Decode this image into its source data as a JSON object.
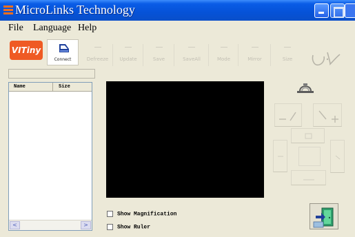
{
  "window": {
    "title": "MicroLinks Technology"
  },
  "menu": [
    "File",
    "Language",
    "Help"
  ],
  "toolbar": {
    "logo_text": "VITiny",
    "connect_label": "Connect",
    "disabled_tools": [
      "Defreeze",
      "Update",
      "Save",
      "SaveAll",
      "Mode",
      "Mirror",
      "Size"
    ]
  },
  "file_list": {
    "columns": [
      "Name",
      "Size"
    ],
    "scroll_left": "<",
    "scroll_right": ">"
  },
  "options": {
    "show_magnification": "Show Magnification",
    "show_ruler": "Show Ruler"
  },
  "colors": {
    "titlebar": "#0552d8",
    "logo": "#ef5a24",
    "screen": "#000000",
    "background": "#ece9d8"
  }
}
